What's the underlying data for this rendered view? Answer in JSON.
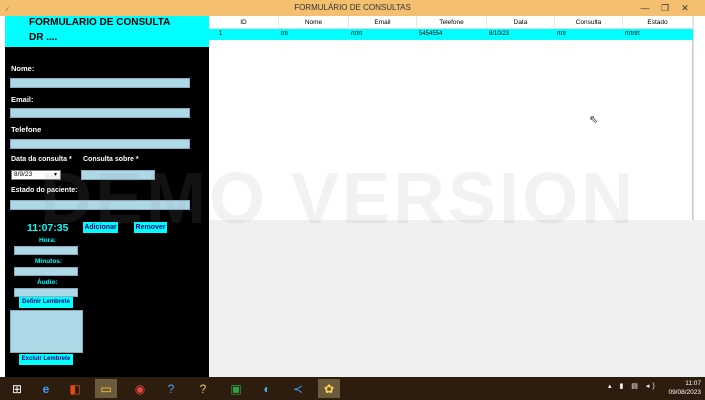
{
  "window": {
    "title": "FORMULÁRIO DE CONSULTAS",
    "min": "—",
    "max": "❐",
    "close": "✕"
  },
  "form": {
    "header_line1": "FORMULARIO DE CONSULTA",
    "header_line2": "DR ....",
    "nome_label": "Nome:",
    "email_label": "Email:",
    "telefone_label": "Telefone",
    "data_label": "Data da consulta *",
    "consulta_label": "Consulta sobre *",
    "date_value": "8/9/23",
    "estado_label": "Estado do paciente:",
    "adicionar": "Adicionar",
    "remover": "Remover"
  },
  "reminder": {
    "clock": "11:07:35",
    "hora_label": "Hora:",
    "minutos_label": "Minutos:",
    "audio_label": "Áudio:",
    "definir": "Definir Lembrete",
    "excluir": "Excluir Lembrete"
  },
  "table": {
    "columns": [
      "ID",
      "Nome",
      "Email",
      "Telefone",
      "Data",
      "Consulta",
      "Estado"
    ],
    "row": [
      "1",
      "trtr",
      "rtrtrt",
      "5454554",
      "8/10/23",
      "rtrtr",
      "rtrtrtrt"
    ]
  },
  "watermark": "DEMO VERSION",
  "taskbar": {
    "time": "11:07",
    "date": "09/08/2023"
  }
}
